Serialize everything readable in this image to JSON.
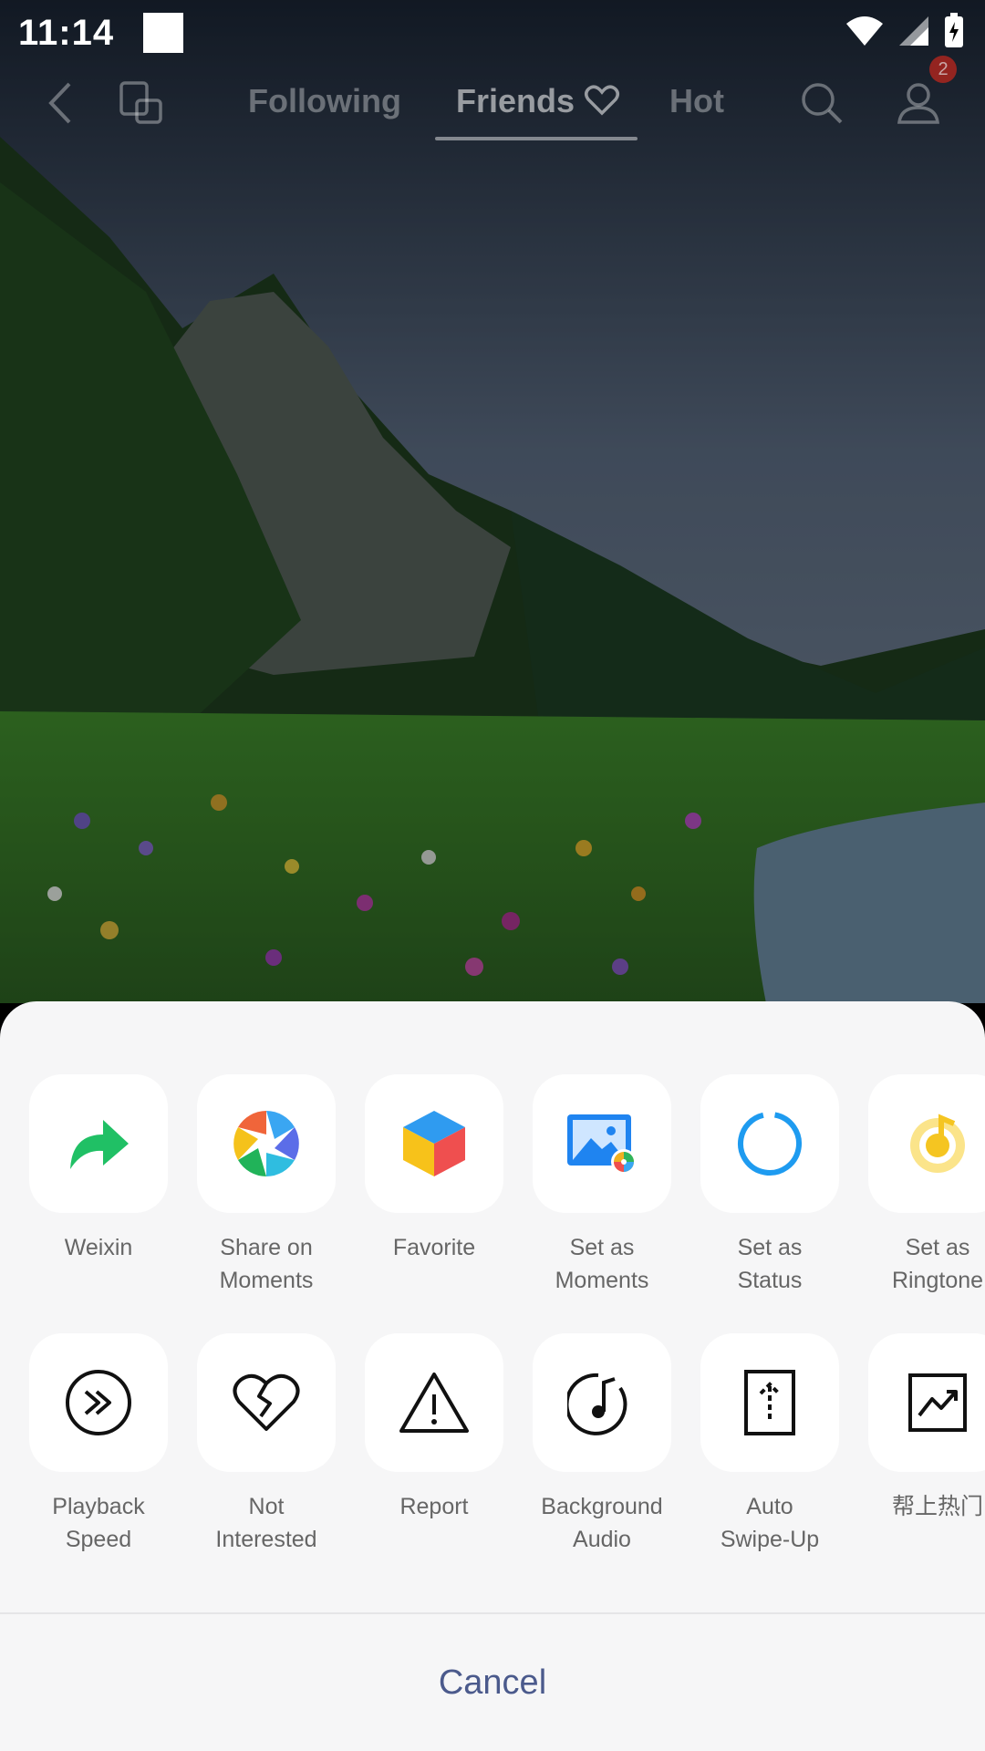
{
  "status_bar": {
    "time": "11:14"
  },
  "top_nav": {
    "tabs": [
      {
        "label": "Following"
      },
      {
        "label": "Friends"
      },
      {
        "label": "Hot"
      }
    ],
    "active_tab": "Friends",
    "notification_count": "2"
  },
  "share_sheet": {
    "row1": [
      {
        "label": "Weixin",
        "icon": "weixin-share-icon"
      },
      {
        "label": "Share on\nMoments",
        "icon": "moments-shutter-icon"
      },
      {
        "label": "Favorite",
        "icon": "favorite-cube-icon"
      },
      {
        "label": "Set as\nMoments",
        "icon": "moments-image-icon"
      },
      {
        "label": "Set as\nStatus",
        "icon": "status-ring-icon"
      },
      {
        "label": "Set as\nRingtone",
        "icon": "ringtone-icon"
      }
    ],
    "row2": [
      {
        "label": "Playback\nSpeed",
        "icon": "playback-speed-icon"
      },
      {
        "label": "Not\nInterested",
        "icon": "broken-heart-icon"
      },
      {
        "label": "Report",
        "icon": "warning-icon"
      },
      {
        "label": "Background\nAudio",
        "icon": "music-note-icon"
      },
      {
        "label": "Auto\nSwipe-Up",
        "icon": "swipe-up-icon"
      },
      {
        "label": "帮上热门",
        "icon": "trending-icon"
      }
    ],
    "cancel_label": "Cancel"
  },
  "colors": {
    "sheet_bg": "#f6f6f7",
    "cancel_text": "#4b5a8c",
    "weixin_green": "#20c065",
    "status_blue": "#1e9bf0",
    "badge_red": "#b3261e"
  }
}
